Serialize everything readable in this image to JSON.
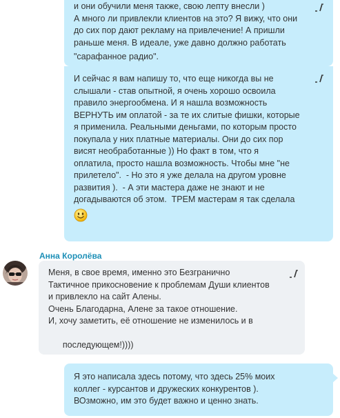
{
  "conversation": {
    "outgoing_1": {
      "lines": [
        "и они обучили меня также, свою лепту внесли )",
        "А много ли привлекли клиентов на это? Я вижу, что они",
        "до сих пор дают рекламу на привлечение! А пришли",
        "раньше меня. В идеале, уже давно должно работать",
        "\"сарафанное радио\"."
      ]
    },
    "outgoing_2": {
      "lines": [
        "И сейчас я вам напишу то, что еще никогда вы не",
        "слышали - став опытной, я очень хорошо освоила",
        "правило энергообмена. И я нашла возможность",
        "ВЕРНУТЬ им оплатой - за те их слитые фишки, которые",
        "я применила. Реальными деньгами, по которым просто",
        "покупала у них платные материалы. Они до сих пор",
        "висят необработанные )) Но факт в том, что я",
        "оплатила, просто нашла возможность. Чтобы мне \"не",
        "прилетело\".  - Но это я уже делала на другом уровне",
        "развития ).  - А эти мастера даже не знают и не",
        "догадываются об этом.  ТРЕМ мастерам я так сделала"
      ],
      "emoji": "smiley-emoji-icon"
    },
    "incoming": {
      "sender": "Анна Королёва",
      "lines": [
        "Меня, в свое время, именно это Безгранично",
        "Тактичное прикосновение к проблемам Души клиентов",
        "и привлекло на сайт Алены.",
        "Очень Благодарна, Алене за такое отношение.",
        "И, хочу заметить, её отношение не изменилось и в",
        "последующем!))))"
      ],
      "emoji": "red-heart-emoji-icon"
    },
    "outgoing_3": {
      "lines": [
        "Я это написала здесь потому, что здесь 25% моих",
        "коллег - курсантов и дружеских конкурентов ).",
        "ВОзможно, им это будет важно и ценно знать."
      ]
    }
  },
  "colors": {
    "outgoing_bubble": "#c7edfc",
    "incoming_bubble": "#eef1f4",
    "sender_name": "#1d8fb7",
    "text": "#333333"
  },
  "icons": [
    "edit-pencil-icon",
    "smiley-emoji-icon",
    "red-heart-emoji-icon",
    "avatar"
  ]
}
